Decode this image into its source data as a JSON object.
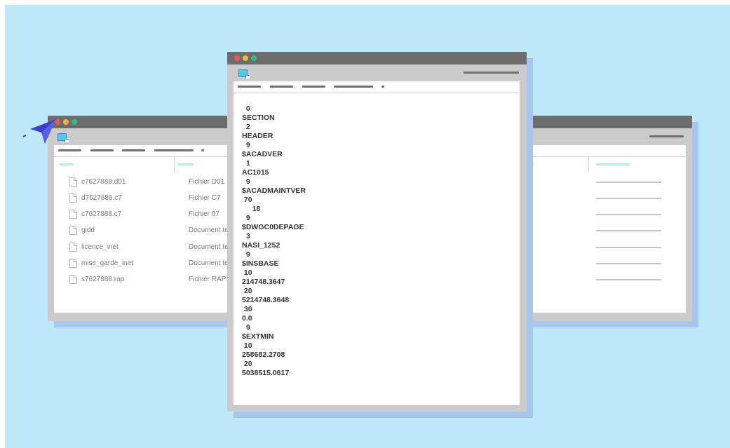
{
  "back_window": {
    "files": [
      {
        "name": "c7627888.d01",
        "type": "Fichier D01"
      },
      {
        "name": "d7627888.c7",
        "type": "Fichier C7"
      },
      {
        "name": "c7627888.c7",
        "type": "Fichier 07"
      },
      {
        "name": "gidd",
        "type": "Document texte"
      },
      {
        "name": "licence_inet",
        "type": "Document texte"
      },
      {
        "name": "mise_garde_inet",
        "type": "Document texte"
      },
      {
        "name": "s7627888.rap",
        "type": "Fichier RAP"
      }
    ],
    "percent_symbol": "%"
  },
  "front_window": {
    "lines": [
      "  0",
      "SECTION",
      "  2",
      "HEADER",
      "  9",
      "$ACADVER",
      "  1",
      "AC1015",
      "  9",
      "$ACADMAINTVER",
      " 70",
      "     18",
      "  9",
      "$DWGC0DEPAGE",
      "  3",
      "NASI_1252",
      "  9",
      "$INSBASE",
      " 10",
      "214748.3647",
      " 20",
      "5214748.3648",
      " 30",
      "0.0",
      "  9",
      "$EXTMIN",
      " 10",
      "258682.2708",
      " 20",
      "5038515.0617"
    ]
  },
  "colors": {
    "background": "#bde8f9",
    "titlebar": "#6d6d6d",
    "frame": "#cbcbcb",
    "shadow": "#a7c6ee",
    "dot_red": "#e45c4f",
    "dot_yellow": "#efb33e",
    "dot_green": "#3bb48f",
    "cursor": "#3b3fc7"
  },
  "icons": [
    "app-icon",
    "file-icon",
    "cursor-arrow-icon"
  ]
}
